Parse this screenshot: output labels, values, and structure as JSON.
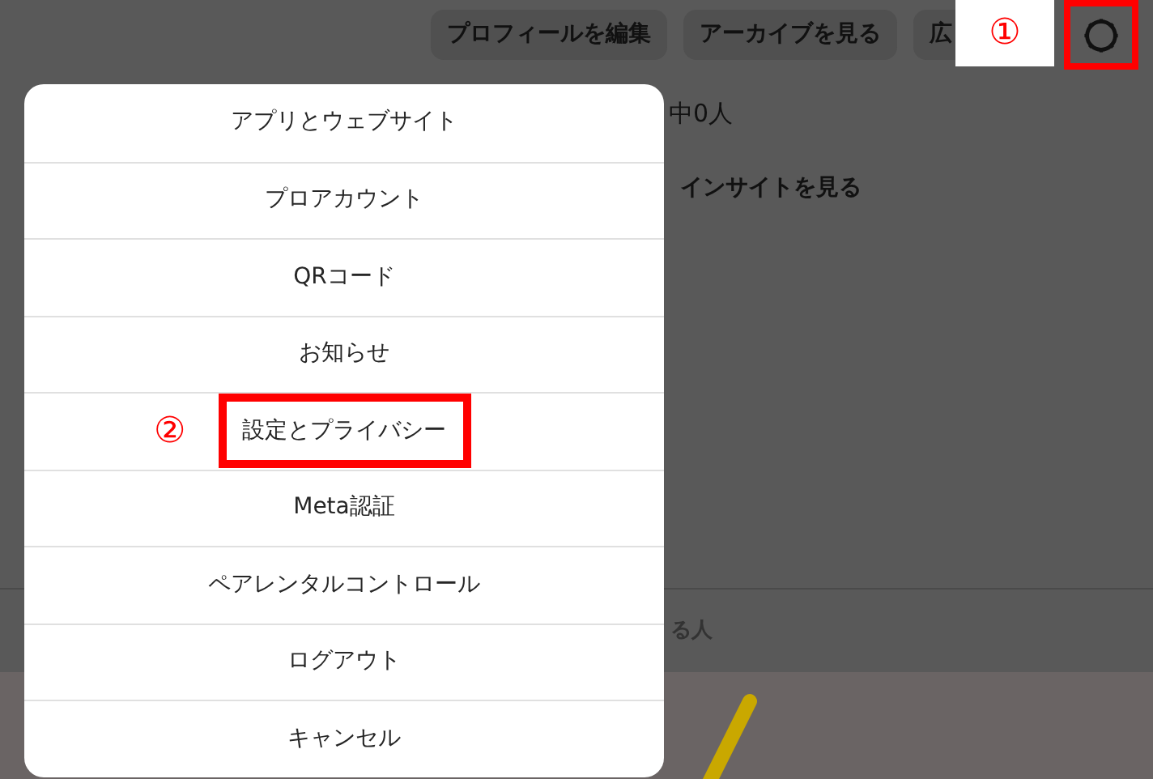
{
  "header": {
    "buttons": [
      {
        "label": "プロフィールを編集"
      },
      {
        "label": "アーカイブを見る"
      },
      {
        "label": "広"
      }
    ],
    "settings_highlighted": true
  },
  "annotations": [
    {
      "label": "①"
    },
    {
      "label": "②"
    }
  ],
  "background": {
    "stat_text": "中0人",
    "insights_link": "インサイトを見る",
    "tab_text": "る人"
  },
  "menu": {
    "items": [
      {
        "label": "アプリとウェブサイト",
        "highlighted": false
      },
      {
        "label": "プロアカウント",
        "highlighted": false
      },
      {
        "label": "QRコード",
        "highlighted": false
      },
      {
        "label": "お知らせ",
        "highlighted": false
      },
      {
        "label": "設定とプライバシー",
        "highlighted": true
      },
      {
        "label": "Meta認証",
        "highlighted": false
      },
      {
        "label": "ペアレンタルコントロール",
        "highlighted": false
      },
      {
        "label": "ログアウト",
        "highlighted": false
      },
      {
        "label": "キャンセル",
        "highlighted": false
      }
    ]
  }
}
